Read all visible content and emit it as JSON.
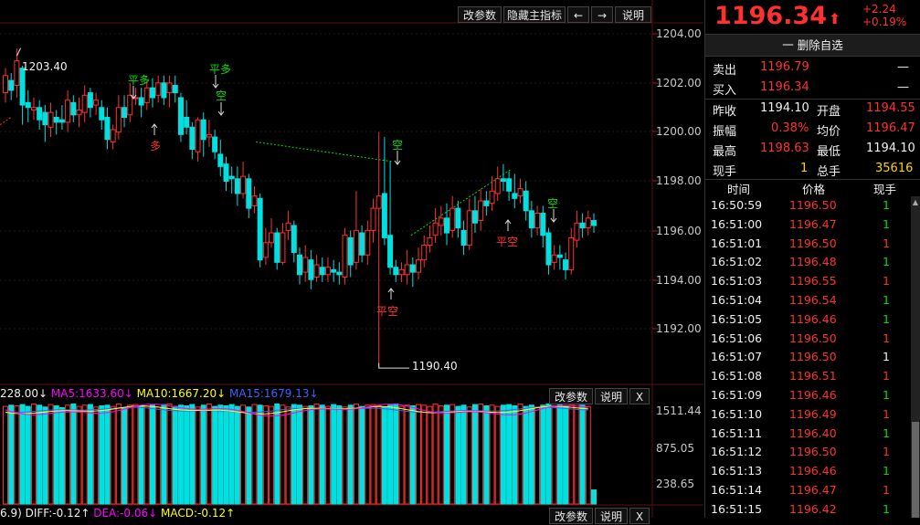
{
  "colors": {
    "up": "#ff3030",
    "down": "#00e0e0",
    "green": "#00e000",
    "ma5": "#ff00ff",
    "ma10": "#ffff00",
    "ma15": "#4060ff",
    "dash_up": "#00e000"
  },
  "main_toolbar": {
    "params": "改参数",
    "hide": "隐藏主指标",
    "prev": "←",
    "next": "→",
    "help": "说明"
  },
  "price_axis": [
    "1204.00",
    "1202.00",
    "1200.00",
    "1198.00",
    "1196.00",
    "1194.00",
    "1192.00"
  ],
  "annotations": {
    "high": "1203.40",
    "low": "1190.40",
    "signals": [
      {
        "label": "平多",
        "color": "green"
      },
      {
        "label": "多",
        "color": "red"
      },
      {
        "label": "平多",
        "color": "green"
      },
      {
        "label": "空",
        "color": "green"
      },
      {
        "label": "空",
        "color": "green"
      },
      {
        "label": "平空",
        "color": "red"
      },
      {
        "label": "平空",
        "color": "red"
      },
      {
        "label": "空",
        "color": "green"
      }
    ]
  },
  "volume_panel": {
    "legend": {
      "vol": "228.00↓",
      "ma5": "MA5:1633.60↓",
      "ma10": "MA10:1667.20↓",
      "ma15": "MA15:1679.13↓"
    },
    "params": "改参数",
    "help": "说明",
    "close": "X",
    "axis": [
      "1511.44",
      "875.05",
      "238.65"
    ]
  },
  "macd_panel": {
    "legend": {
      "a": "6.9)",
      "diff": "DIFF:-0.12↑",
      "dea": "DEA:-0.06↓",
      "macd": "MACD:-0.12↑"
    },
    "params": "改参数",
    "help": "说明",
    "close": "X"
  },
  "quote": {
    "price": "1196.34",
    "arrow": "⬆",
    "change": "+2.24",
    "change_pct": "+0.19%",
    "remove_watch": "一 删除自选",
    "sell_label": "卖出",
    "sell_price": "1196.79",
    "sell_vol": "—",
    "buy_label": "买入",
    "buy_price": "1196.34",
    "buy_vol": "—",
    "prev_close_label": "昨收",
    "prev_close": "1194.10",
    "open_label": "开盘",
    "open": "1194.55",
    "amplitude_label": "振幅",
    "amplitude": "0.38%",
    "avg_label": "均价",
    "avg": "1196.47",
    "high_label": "最高",
    "high": "1198.63",
    "low_label": "最低",
    "low": "1194.10",
    "cur_vol_label": "现手",
    "cur_vol": "1",
    "total_label": "总手",
    "total": "35616"
  },
  "ticks_header": {
    "time": "时间",
    "price": "价格",
    "vol": "现手"
  },
  "ticks": [
    {
      "time": "16:50:59",
      "price": "1196.50",
      "vol": "1",
      "dir": "g"
    },
    {
      "time": "16:51:00",
      "price": "1196.47",
      "vol": "1",
      "dir": "g"
    },
    {
      "time": "16:51:01",
      "price": "1196.50",
      "vol": "1",
      "dir": "r"
    },
    {
      "time": "16:51:02",
      "price": "1196.48",
      "vol": "1",
      "dir": "g"
    },
    {
      "time": "16:51:03",
      "price": "1196.55",
      "vol": "1",
      "dir": "r"
    },
    {
      "time": "16:51:04",
      "price": "1196.54",
      "vol": "1",
      "dir": "g"
    },
    {
      "time": "16:51:05",
      "price": "1196.46",
      "vol": "1",
      "dir": "g"
    },
    {
      "time": "16:51:06",
      "price": "1196.50",
      "vol": "1",
      "dir": "r"
    },
    {
      "time": "16:51:07",
      "price": "1196.50",
      "vol": "1",
      "dir": "w"
    },
    {
      "time": "16:51:08",
      "price": "1196.51",
      "vol": "1",
      "dir": "r"
    },
    {
      "time": "16:51:09",
      "price": "1196.46",
      "vol": "1",
      "dir": "g"
    },
    {
      "time": "16:51:10",
      "price": "1196.49",
      "vol": "1",
      "dir": "r"
    },
    {
      "time": "16:51:11",
      "price": "1196.40",
      "vol": "1",
      "dir": "g"
    },
    {
      "time": "16:51:12",
      "price": "1196.50",
      "vol": "1",
      "dir": "r"
    },
    {
      "time": "16:51:13",
      "price": "1196.46",
      "vol": "1",
      "dir": "g"
    },
    {
      "time": "16:51:14",
      "price": "1196.47",
      "vol": "1",
      "dir": "r"
    },
    {
      "time": "16:51:15",
      "price": "1196.42",
      "vol": "1",
      "dir": "g"
    }
  ],
  "candles": [
    [
      1201.6,
      1202.3,
      1201.2,
      1202.6
    ],
    [
      1202.1,
      1201.7,
      1201.3,
      1202.4
    ],
    [
      1201.9,
      1202.9,
      1201.4,
      1203.4
    ],
    [
      1202.6,
      1201.1,
      1200.3,
      1202.7
    ],
    [
      1201.2,
      1201.0,
      1200.4,
      1201.7
    ],
    [
      1200.9,
      1201.0,
      1200.5,
      1201.4
    ],
    [
      1201.0,
      1200.5,
      1200.1,
      1201.3
    ],
    [
      1200.8,
      1200.3,
      1199.6,
      1201.1
    ],
    [
      1200.2,
      1200.8,
      1199.8,
      1201.2
    ],
    [
      1200.6,
      1200.4,
      1199.9,
      1200.9
    ],
    [
      1200.5,
      1200.4,
      1200.1,
      1201.1
    ],
    [
      1200.4,
      1201.3,
      1200.0,
      1201.7
    ],
    [
      1201.2,
      1200.7,
      1200.4,
      1201.5
    ],
    [
      1200.7,
      1200.9,
      1200.2,
      1201.4
    ],
    [
      1200.8,
      1201.5,
      1200.4,
      1201.9
    ],
    [
      1201.6,
      1201.0,
      1200.6,
      1201.8
    ],
    [
      1201.1,
      1201.3,
      1200.7,
      1201.6
    ],
    [
      1201.0,
      1200.5,
      1200.1,
      1201.3
    ],
    [
      1200.6,
      1199.7,
      1199.3,
      1201.0
    ],
    [
      1199.6,
      1200.1,
      1199.3,
      1200.3
    ],
    [
      1200.0,
      1201.0,
      1199.7,
      1201.5
    ],
    [
      1201.0,
      1200.6,
      1200.2,
      1201.5
    ],
    [
      1200.7,
      1201.5,
      1200.4,
      1202.0
    ],
    [
      1201.4,
      1201.4,
      1201.1,
      1201.8
    ],
    [
      1201.4,
      1201.1,
      1200.6,
      1201.8
    ],
    [
      1201.2,
      1201.8,
      1200.9,
      1202.1
    ],
    [
      1201.8,
      1201.4,
      1201.0,
      1202.2
    ],
    [
      1201.5,
      1202.0,
      1201.2,
      1202.3
    ],
    [
      1202.0,
      1201.4,
      1201.1,
      1202.3
    ],
    [
      1201.6,
      1202.0,
      1201.0,
      1202.3
    ],
    [
      1201.9,
      1201.6,
      1201.2,
      1202.3
    ],
    [
      1201.4,
      1199.9,
      1199.6,
      1201.6
    ],
    [
      1200.6,
      1200.2,
      1199.9,
      1201.3
    ],
    [
      1200.2,
      1199.3,
      1198.9,
      1200.4
    ],
    [
      1199.2,
      1200.5,
      1198.8,
      1200.6
    ],
    [
      1200.5,
      1199.7,
      1199.0,
      1200.8
    ],
    [
      1199.8,
      1199.9,
      1199.4,
      1200.5
    ],
    [
      1199.8,
      1199.2,
      1198.9,
      1200.1
    ],
    [
      1199.1,
      1198.6,
      1198.2,
      1199.7
    ],
    [
      1198.7,
      1198.0,
      1197.6,
      1199.0
    ],
    [
      1198.2,
      1198.1,
      1197.5,
      1198.6
    ],
    [
      1198.1,
      1197.5,
      1197.0,
      1198.6
    ],
    [
      1197.5,
      1198.2,
      1197.3,
      1198.8
    ],
    [
      1198.1,
      1196.9,
      1196.5,
      1198.3
    ],
    [
      1197.0,
      1197.4,
      1196.7,
      1197.8
    ],
    [
      1197.3,
      1194.8,
      1194.5,
      1197.5
    ],
    [
      1194.9,
      1195.5,
      1194.6,
      1196.1
    ],
    [
      1195.5,
      1195.9,
      1195.3,
      1196.5
    ],
    [
      1195.9,
      1194.7,
      1194.4,
      1196.1
    ],
    [
      1194.7,
      1195.9,
      1194.6,
      1196.3
    ],
    [
      1196.0,
      1196.3,
      1195.6,
      1196.8
    ],
    [
      1196.2,
      1195.1,
      1194.7,
      1196.4
    ],
    [
      1195.0,
      1194.2,
      1193.8,
      1195.3
    ],
    [
      1194.3,
      1194.9,
      1193.9,
      1195.4
    ],
    [
      1194.8,
      1194.0,
      1193.6,
      1195.2
    ],
    [
      1194.1,
      1194.6,
      1193.9,
      1195.0
    ],
    [
      1194.5,
      1194.2,
      1193.9,
      1194.9
    ],
    [
      1194.2,
      1194.5,
      1193.9,
      1194.9
    ],
    [
      1194.4,
      1194.3,
      1193.9,
      1194.8
    ],
    [
      1194.3,
      1194.2,
      1193.8,
      1194.7
    ],
    [
      1194.1,
      1195.8,
      1193.8,
      1196.1
    ],
    [
      1195.7,
      1194.6,
      1194.1,
      1196.0
    ],
    [
      1194.7,
      1196.0,
      1194.4,
      1197.6
    ],
    [
      1195.9,
      1195.0,
      1194.7,
      1196.2
    ],
    [
      1195.0,
      1196.0,
      1194.6,
      1196.4
    ],
    [
      1196.0,
      1196.9,
      1195.5,
      1197.3
    ],
    [
      1196.9,
      1197.4,
      1190.4,
      1200.0
    ],
    [
      1197.5,
      1195.7,
      1195.4,
      1199.8
    ],
    [
      1195.8,
      1194.5,
      1194.2,
      1198.8
    ],
    [
      1194.5,
      1194.2,
      1193.9,
      1194.8
    ],
    [
      1194.2,
      1194.4,
      1193.9,
      1194.7
    ],
    [
      1194.2,
      1194.6,
      1193.8,
      1195.2
    ],
    [
      1194.6,
      1194.3,
      1193.7,
      1194.9
    ],
    [
      1194.3,
      1194.8,
      1194.0,
      1195.3
    ],
    [
      1194.8,
      1195.4,
      1194.5,
      1195.8
    ],
    [
      1195.4,
      1195.7,
      1195.1,
      1196.2
    ],
    [
      1195.8,
      1196.3,
      1195.5,
      1196.9
    ],
    [
      1196.2,
      1196.5,
      1195.8,
      1197.0
    ],
    [
      1196.5,
      1195.9,
      1195.4,
      1197.1
    ],
    [
      1196.0,
      1196.9,
      1195.7,
      1197.4
    ],
    [
      1196.9,
      1196.1,
      1195.7,
      1197.2
    ],
    [
      1196.0,
      1195.4,
      1195.0,
      1196.4
    ],
    [
      1195.4,
      1196.8,
      1195.2,
      1197.3
    ],
    [
      1196.8,
      1196.3,
      1195.9,
      1197.4
    ],
    [
      1196.4,
      1197.2,
      1196.0,
      1197.7
    ],
    [
      1197.2,
      1197.0,
      1196.6,
      1197.6
    ],
    [
      1197.1,
      1197.6,
      1196.8,
      1198.2
    ],
    [
      1197.5,
      1198.1,
      1197.2,
      1198.6
    ],
    [
      1198.1,
      1198.0,
      1197.6,
      1198.7
    ],
    [
      1198.1,
      1197.6,
      1197.2,
      1198.4
    ],
    [
      1197.5,
      1197.3,
      1196.9,
      1198.3
    ],
    [
      1197.4,
      1197.7,
      1197.1,
      1198.1
    ],
    [
      1197.6,
      1196.8,
      1196.4,
      1198.0
    ],
    [
      1196.8,
      1196.1,
      1195.7,
      1197.2
    ],
    [
      1196.1,
      1196.7,
      1195.8,
      1197.0
    ],
    [
      1196.7,
      1195.8,
      1195.3,
      1197.0
    ],
    [
      1195.9,
      1194.6,
      1194.2,
      1196.1
    ],
    [
      1194.7,
      1195.0,
      1194.4,
      1195.4
    ],
    [
      1195.0,
      1194.9,
      1194.4,
      1195.4
    ],
    [
      1194.8,
      1194.4,
      1194.0,
      1195.1
    ],
    [
      1194.4,
      1195.7,
      1194.2,
      1196.1
    ],
    [
      1195.6,
      1196.3,
      1195.3,
      1196.8
    ],
    [
      1196.3,
      1196.1,
      1195.7,
      1196.7
    ],
    [
      1196.1,
      1196.5,
      1195.8,
      1196.8
    ],
    [
      1196.4,
      1196.2,
      1195.9,
      1196.7
    ]
  ],
  "volumes": [
    1580,
    1600,
    1590,
    1610,
    1580,
    1620,
    1600,
    1570,
    1610,
    1590,
    1560,
    1600,
    1620,
    1580,
    1600,
    1610,
    1570,
    1590,
    1600,
    1580,
    1620,
    1560,
    1600,
    1610,
    1590,
    1580,
    1600,
    1570,
    1610,
    1620,
    1580,
    1600,
    1590,
    1610,
    1570,
    1600,
    1620,
    1580,
    1600,
    1590,
    1610,
    1580,
    1600,
    1570,
    1610,
    1600,
    1590,
    1580,
    1620,
    1600,
    1570,
    1610,
    1600,
    1580,
    1590,
    1620,
    1600,
    1580,
    1610,
    1590,
    1570,
    1600,
    1620,
    1580,
    1600,
    1610,
    1590,
    1570,
    1600,
    1620,
    1580,
    1600,
    1590,
    1610,
    1600,
    1580,
    1620,
    1590,
    1600,
    1610,
    1580,
    1600,
    1570,
    1610,
    1620,
    1590,
    1600,
    1580,
    1600,
    1610,
    1590,
    1620,
    1580,
    1600,
    1570,
    1600,
    1620,
    1590,
    1610,
    1580,
    1600,
    1620,
    1600,
    1580,
    228
  ]
}
